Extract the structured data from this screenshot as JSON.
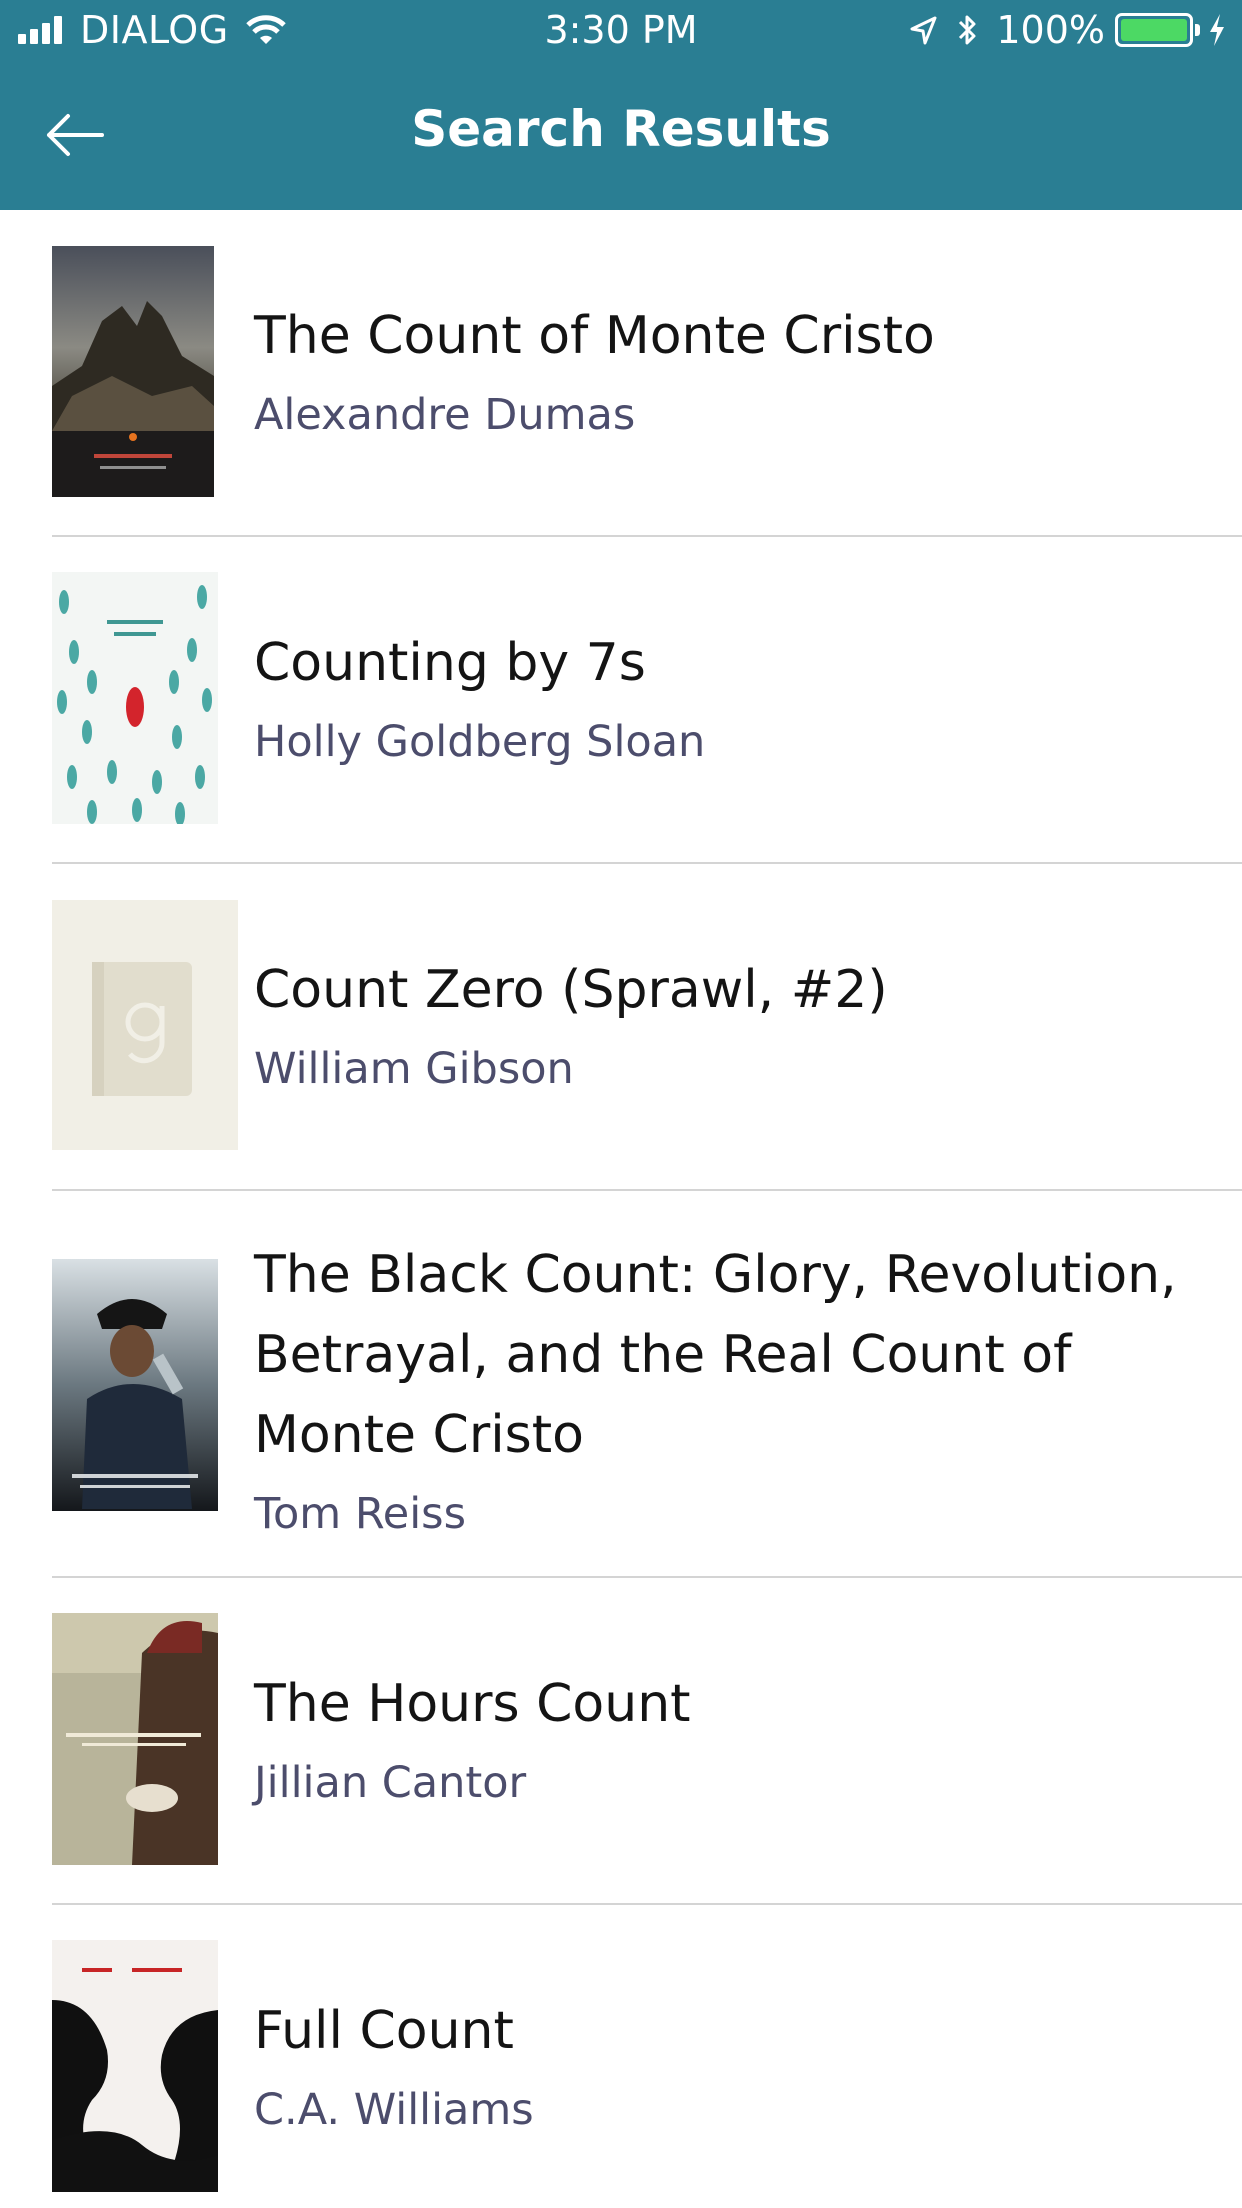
{
  "status_bar": {
    "carrier": "DIALOG",
    "time": "3:30 PM",
    "battery": "100%",
    "battery_level": 1.0,
    "colors": {
      "battery_fill": "#4cd964"
    }
  },
  "nav": {
    "title": "Search Results",
    "back_icon": "arrow-left-icon",
    "background": "#2a7e93"
  },
  "results": [
    {
      "title": "The Count of Monte Cristo",
      "author": "Alexandre Dumas",
      "cover_icon": "book-cover"
    },
    {
      "title": "Counting by 7s",
      "author": "Holly Goldberg Sloan",
      "cover_icon": "book-cover"
    },
    {
      "title": "Count Zero (Sprawl, #2)",
      "author": "William Gibson",
      "cover_icon": "placeholder-g-icon"
    },
    {
      "title": "The Black Count: Glory, Revolution, Betrayal, and the Real Count of Monte Cristo",
      "author": "Tom Reiss",
      "cover_icon": "book-cover"
    },
    {
      "title": "The Hours Count",
      "author": "Jillian Cantor",
      "cover_icon": "book-cover"
    },
    {
      "title": "Full Count",
      "author": "C.A. Williams",
      "cover_icon": "book-cover"
    }
  ]
}
